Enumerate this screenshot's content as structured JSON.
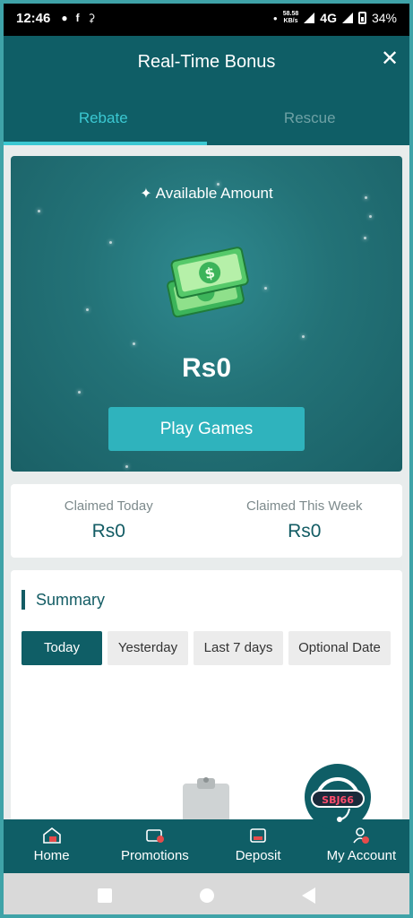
{
  "status_bar": {
    "time": "12:46",
    "net_speed_value": "58.58",
    "net_speed_unit": "KB/s",
    "network": "4G",
    "battery": "34%"
  },
  "header": {
    "title": "Real-Time Bonus",
    "close_icon": "close-icon"
  },
  "tabs": [
    {
      "label": "Rebate",
      "active": true
    },
    {
      "label": "Rescue",
      "active": false
    }
  ],
  "hero": {
    "available_label": "Available Amount",
    "amount": "Rs0",
    "play_button": "Play Games"
  },
  "claimed": {
    "today_label": "Claimed Today",
    "today_value": "Rs0",
    "week_label": "Claimed This Week",
    "week_value": "Rs0"
  },
  "summary": {
    "title": "Summary",
    "filters": [
      {
        "label": "Today",
        "active": true
      },
      {
        "label": "Yesterday",
        "active": false
      },
      {
        "label": "Last 7 days",
        "active": false
      },
      {
        "label": "Optional Date",
        "active": false
      }
    ]
  },
  "float_logo": {
    "text": "SBJ66"
  },
  "bottom_nav": [
    {
      "label": "Home",
      "icon": "home-icon"
    },
    {
      "label": "Promotions",
      "icon": "promotions-icon"
    },
    {
      "label": "Deposit",
      "icon": "deposit-icon"
    },
    {
      "label": "My Account",
      "icon": "account-icon"
    }
  ],
  "colors": {
    "primary": "#0f5e66",
    "accent": "#2fb3bd",
    "tab_active": "#3bc8d2"
  }
}
